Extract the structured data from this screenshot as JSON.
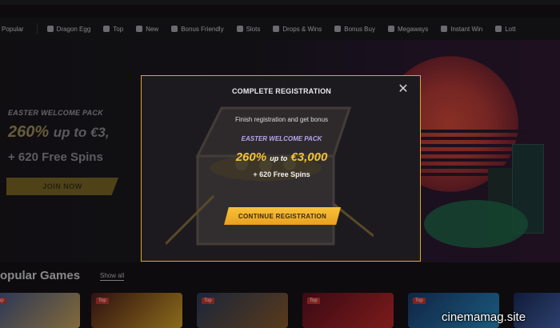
{
  "nav": {
    "items": [
      {
        "label": "Popular",
        "icon": "popular-icon"
      },
      {
        "label": "Dragon Egg",
        "icon": "dragon-egg-icon"
      },
      {
        "label": "Top",
        "icon": "flame-icon"
      },
      {
        "label": "New",
        "icon": "new-icon"
      },
      {
        "label": "Bonus Friendly",
        "icon": "bonus-friendly-icon"
      },
      {
        "label": "Slots",
        "icon": "slots-icon"
      },
      {
        "label": "Drops & Wins",
        "icon": "drops-wins-icon"
      },
      {
        "label": "Bonus Buy",
        "icon": "bonus-buy-icon"
      },
      {
        "label": "Megaways",
        "icon": "megaways-icon"
      },
      {
        "label": "Instant Win",
        "icon": "instant-win-icon"
      },
      {
        "label": "Lott",
        "icon": "lottery-icon"
      }
    ]
  },
  "hero": {
    "tag": "EASTER WELCOME PACK",
    "title_main": "260%",
    "title_rest": "up to €3,",
    "spins": "+ 620 Free Spins",
    "join_label": "JOIN NOW"
  },
  "games": {
    "section_title": "opular Games",
    "show_all": "Show all",
    "badge": "Top"
  },
  "modal": {
    "title": "COMPLETE REGISTRATION",
    "finish_text": "Finish registration and get bonus",
    "pack_label": "EASTER WELCOME PACK",
    "bonus_pct": "260%",
    "bonus_up": "up to",
    "bonus_amount": "€3,000",
    "spins": "+ 620 Free Spins",
    "cta_label": "CONTINUE REGISTRATION"
  },
  "watermark": "cinemamag.site",
  "colors": {
    "accent": "#f5c431",
    "modal_border": "#d9a92b",
    "pack_label": "#b9a6f0"
  }
}
